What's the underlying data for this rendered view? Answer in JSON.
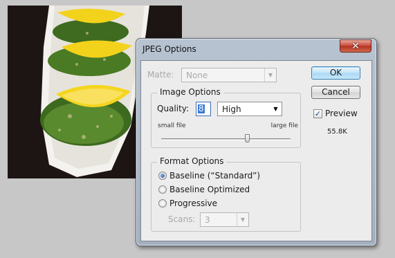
{
  "dialog": {
    "title": "JPEG Options",
    "close_glyph": "✕",
    "matte": {
      "label": "Matte:",
      "value": "None",
      "enabled": false
    },
    "image_options": {
      "group_title": "Image Options",
      "quality_label": "Quality:",
      "quality_value": "8",
      "quality_preset": "High",
      "small_file_label": "small file",
      "large_file_label": "large file",
      "quality_slider": {
        "value": 8,
        "min": 0,
        "max": 12
      }
    },
    "format_options": {
      "group_title": "Format Options",
      "options": [
        {
          "label": "Baseline (“Standard”)",
          "checked": true
        },
        {
          "label": "Baseline Optimized",
          "checked": false
        },
        {
          "label": "Progressive",
          "checked": false
        }
      ],
      "scans_label": "Scans:",
      "scans_value": "3",
      "scans_enabled": false
    },
    "buttons": {
      "ok": "OK",
      "cancel": "Cancel"
    },
    "preview": {
      "label": "Preview",
      "checked": true,
      "check_glyph": "✓",
      "file_size": "55.8K"
    }
  },
  "icons": {
    "dropdown_arrow": "▼"
  },
  "colors": {
    "selection": "#3a79d4",
    "close_button": "#c7473a",
    "ok_button": "#a9d8f4"
  }
}
